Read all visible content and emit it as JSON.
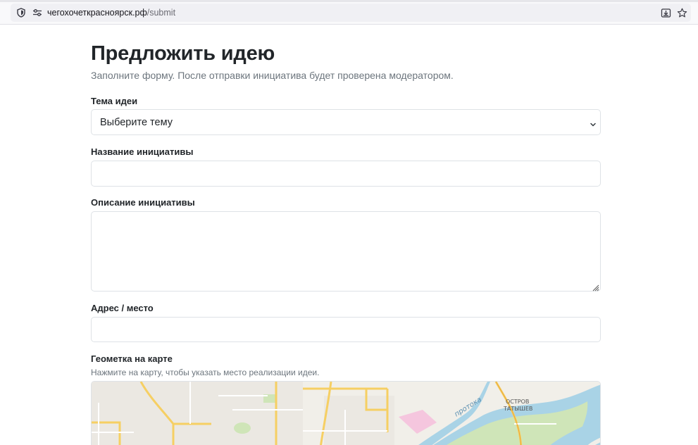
{
  "browser": {
    "url_host": "чегохочеткрасноярск.рф",
    "url_path": "/submit"
  },
  "page": {
    "title": "Предложить идею",
    "subtitle": "Заполните форму. После отправки инициатива будет проверена модератором."
  },
  "form": {
    "topic_label": "Тема идеи",
    "topic_selected": "Выберите тему",
    "name_label": "Название инициативы",
    "name_value": "",
    "description_label": "Описание инициативы",
    "description_value": "",
    "address_label": "Адрес / место",
    "address_value": "",
    "geo_label": "Геометка на карте",
    "geo_hint": "Нажмите на карту, чтобы указать место реализации идеи."
  },
  "map": {
    "labels": {
      "channel": "протока",
      "island_line1": "ОСТРОВ",
      "island_line2": "ТАТЫШЕВ"
    },
    "colors": {
      "land": "#f1efe9",
      "water": "#a9d3e6",
      "road_major": "#f6cf63",
      "road_minor": "#ffffff",
      "park": "#cfe5b8",
      "industrial": "#f5c6de"
    }
  },
  "icons": [
    "shield-icon",
    "site-settings-icon",
    "download-icon",
    "star-icon",
    "chevron-down-icon",
    "resize-grip-icon"
  ]
}
